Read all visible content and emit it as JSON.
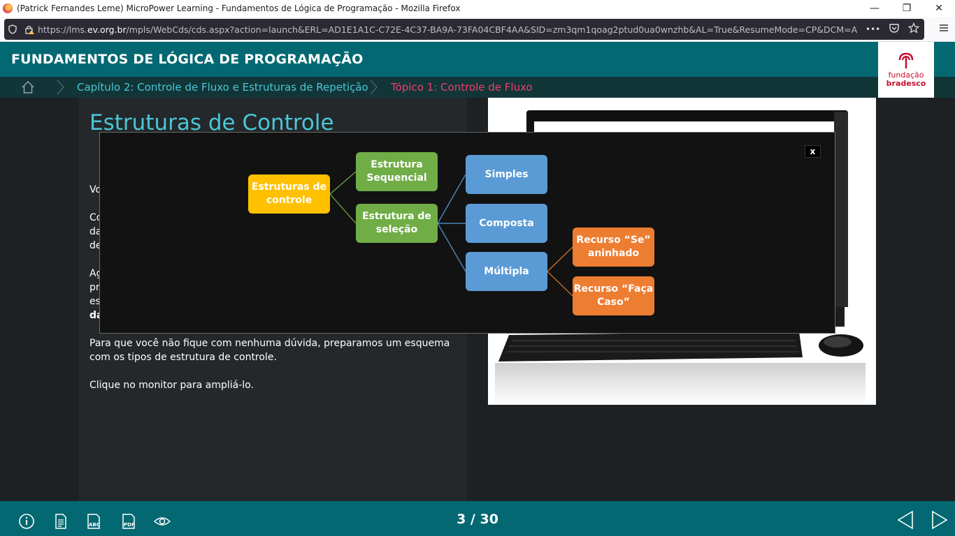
{
  "browser": {
    "window_title": "(Patrick Fernandes Leme) MicroPower Learning - Fundamentos de Lógica de Programação - Mozilla Firefox",
    "url_prefix": "https://lms.",
    "url_domain": "ev.org.br",
    "url_rest": "/mpls/WebCds/cds.aspx?action=launch&ERL=AD1E1A1C-C72E-4C37-BA9A-73FA04CBF4AA&SID=zm3qm1qoag2ptud0ua0wnzhb&AL=True&ResumeMode=CP&DCM=A",
    "url_ellipsis": "•••"
  },
  "header": {
    "course_title": "FUNDAMENTOS DE LÓGICA DE PROGRAMAÇÃO",
    "logo_line1": "fundação",
    "logo_line2": "bradesco"
  },
  "breadcrumb": {
    "chapter": "Capítulo 2: Controle de Fluxo e Estruturas de Repetição",
    "topic": "Tópico 1: Controle de Fluxo"
  },
  "content": {
    "heading": "Estruturas de Controle",
    "fragments": [
      "Vo",
      "Co",
      "da",
      "de",
      "Ag",
      "pr",
      "es",
      "da"
    ],
    "para_scheme": "Para que você não fique com nenhuma dúvida, preparamos um esquema com os tipos de estrutura de controle.",
    "para_click": "Clique no monitor para ampliá-lo."
  },
  "diagram": {
    "close_label": "x",
    "root": "Estruturas de controle",
    "sequencial": "Estrutura Sequencial",
    "selecao": "Estrutura de seleção",
    "simples": "Simples",
    "composta": "Composta",
    "multipla": "Múltipla",
    "se_aninhado": "Recurso “Se” aninhado",
    "faca_caso": "Recurso “Faça Caso”",
    "colors": {
      "root": "#ffc000",
      "green": "#70ad47",
      "blue": "#5b9bd5",
      "orange": "#ed7d31"
    }
  },
  "footer": {
    "page_counter": "3 / 30",
    "tools": [
      "info-icon",
      "document-icon",
      "glossary-abc-icon",
      "pdf-icon",
      "eye-icon"
    ]
  }
}
